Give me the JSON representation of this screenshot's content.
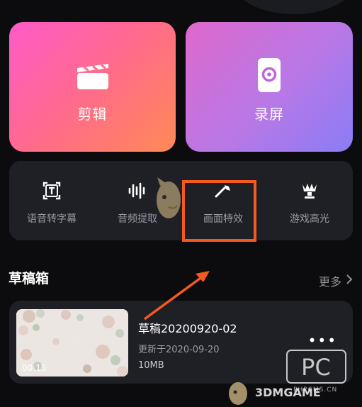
{
  "main_actions": [
    {
      "label": "剪辑",
      "icon": "clapperboard-icon"
    },
    {
      "label": "录屏",
      "icon": "screen-record-icon"
    }
  ],
  "tools": [
    {
      "label": "语音转字幕",
      "icon": "text-box-icon"
    },
    {
      "label": "音频提取",
      "icon": "waveform-icon"
    },
    {
      "label": "画面特效",
      "icon": "magic-wand-icon"
    },
    {
      "label": "游戏高光",
      "icon": "trophy-icon"
    }
  ],
  "drafts": {
    "title": "草稿箱",
    "more_label": "更多",
    "items": [
      {
        "name": "草稿20200920-02",
        "updated": "更新于2020-09-20",
        "size": "10MB",
        "duration": "00:15"
      }
    ]
  },
  "annotation": {
    "highlight_color": "#f25a1f"
  },
  "watermark": {
    "pc_logo": "PC",
    "site_text": "3DMGAME",
    "small_text": "PHPCMS.CN"
  },
  "colors": {
    "background": "#0c0c0e",
    "panel": "#1f1f26",
    "edit_gradient": [
      "#ff5bc9",
      "#ff8a55"
    ],
    "record_gradient": [
      "#de68cc",
      "#8a7cf6"
    ]
  }
}
